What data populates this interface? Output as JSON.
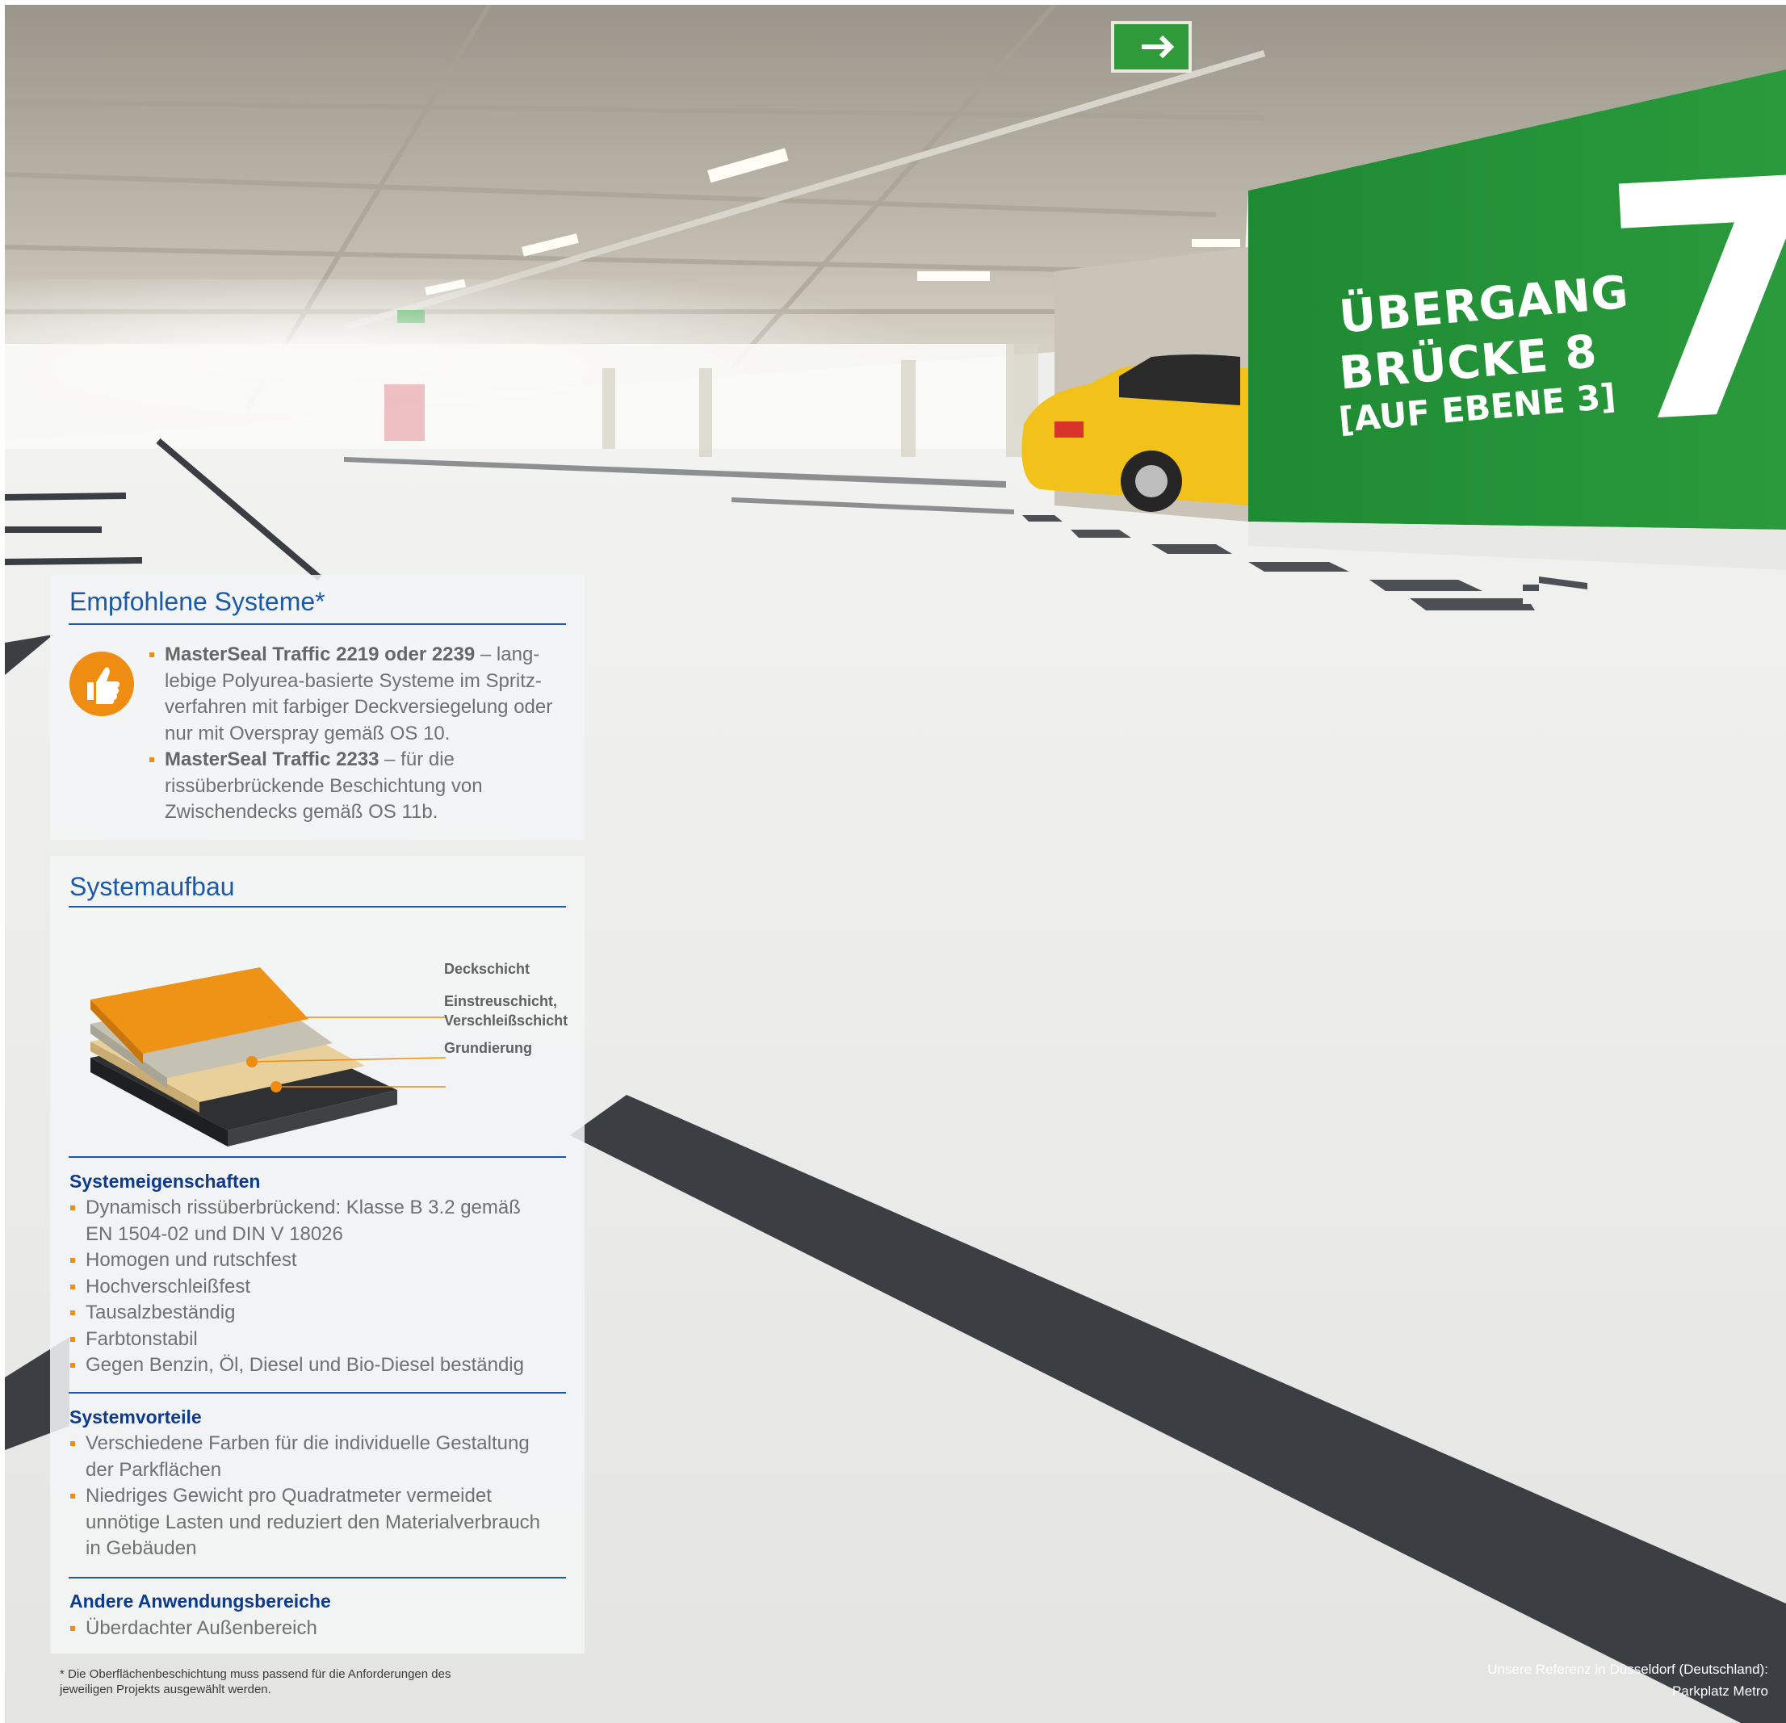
{
  "photo": {
    "wall_sign": {
      "line1": "ÜBERGANG",
      "line2": "BRÜCKE 8",
      "line3": "[AUF EBENE 3]",
      "level_number": "7"
    },
    "colors": {
      "wall_green": "#1f8c34",
      "car_yellow": "#f2c21a",
      "stripe_dark": "#3b3f44"
    }
  },
  "recommended": {
    "title": "Empfohlene Systeme*",
    "icon": "thumbs-up-icon",
    "items": [
      {
        "name": "MasterSeal Traffic 2219 oder 2239",
        "text": " – lang-\nlebige Polyurea-basierte Systeme im Spritz-\nverfahren mit farbiger Deckversiegelung oder\nnur mit Overspray gemäß OS 10."
      },
      {
        "name": "MasterSeal Traffic 2233",
        "text": " – für die\nrissüberbrückende Beschichtung von\nZwischendecks gemäß OS 11b."
      }
    ]
  },
  "system": {
    "title": "Systemaufbau",
    "layers": [
      "Deckschicht",
      "Einstreuschicht,\nVerschleißschicht",
      "Grundierung"
    ],
    "properties": {
      "title": "Systemeigenschaften",
      "items": [
        "Dynamisch rissüberbrückend: Klasse B 3.2 gemäß\nEN 1504-02 und DIN V 18026",
        "Homogen und rutschfest",
        "Hochverschleißfest",
        "Tausalzbeständig",
        "Farbtonstabil",
        "Gegen Benzin, Öl, Diesel und Bio-Diesel beständig"
      ]
    },
    "advantages": {
      "title": "Systemvorteile",
      "items": [
        "Verschiedene Farben für die individuelle Gestaltung\nder Parkflächen",
        "Niedriges Gewicht pro Quadratmeter vermeidet\nunnötige Lasten und reduziert den Materialverbrauch\nin Gebäuden"
      ]
    },
    "other": {
      "title": "Andere Anwendungsbereiche",
      "items": [
        "Überdachter Außenbereich"
      ]
    }
  },
  "footnote": "* Die Oberflächenbeschichtung muss passend für die Anforderungen des\njeweiligen Projekts ausgewählt werden.",
  "caption": "Unsere Referenz in Düsseldorf (Deutschland):\nParkplatz Metro",
  "colors": {
    "heading_blue": "#1b5aa8",
    "subhead_blue": "#0e3a8a",
    "bullet_orange": "#ee8d12",
    "body_grey": "#707070"
  }
}
